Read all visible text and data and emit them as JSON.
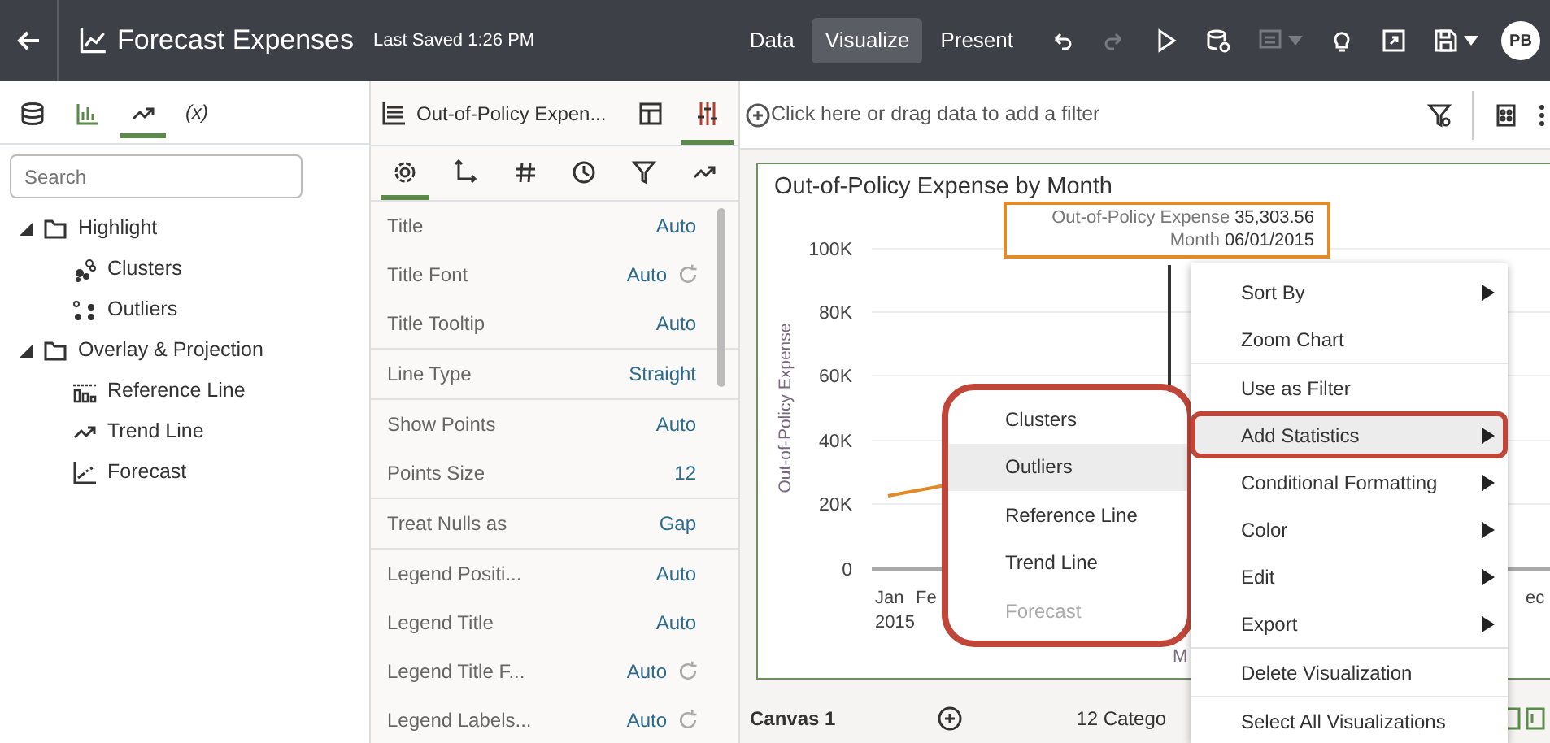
{
  "app_bar": {
    "title": "Forecast Expenses",
    "saved": "Last Saved 1:26 PM",
    "modes": [
      {
        "label": "Data",
        "selected": false
      },
      {
        "label": "Visualize",
        "selected": true
      },
      {
        "label": "Present",
        "selected": false
      }
    ],
    "tools": [
      {
        "kind": "undo",
        "disabled": false
      },
      {
        "kind": "redo",
        "disabled": true
      },
      {
        "kind": "play",
        "disabled": false
      },
      {
        "kind": "data",
        "disabled": false
      },
      {
        "kind": "narrate",
        "disabled": true
      },
      {
        "kind": "bulb",
        "disabled": false
      },
      {
        "kind": "export",
        "disabled": false
      },
      {
        "kind": "save",
        "disabled": false
      }
    ],
    "avatar": "PB"
  },
  "data_panel": {
    "tabs": [
      {
        "kind": "database",
        "selected": false
      },
      {
        "kind": "bars",
        "selected": false
      },
      {
        "kind": "trend",
        "selected": true
      },
      {
        "kind": "text",
        "label": "(x)",
        "selected": false
      }
    ],
    "search": {
      "placeholder": "Search"
    },
    "tree": [
      {
        "label": "Highlight",
        "expanded": true,
        "children": [
          {
            "label": "Clusters",
            "kind": "clusters"
          },
          {
            "label": "Outliers",
            "kind": "outliers"
          }
        ]
      },
      {
        "label": "Overlay & Projection",
        "expanded": true,
        "children": [
          {
            "label": "Reference Line",
            "kind": "reference"
          },
          {
            "label": "Trend Line",
            "kind": "trend"
          },
          {
            "label": "Forecast",
            "kind": "forecast"
          }
        ]
      }
    ]
  },
  "properties": {
    "title": "Out-of-Policy Expen...",
    "views": [
      {
        "kind": "layout",
        "selected": false
      },
      {
        "kind": "sliders",
        "selected": true
      }
    ],
    "tabs": [
      {
        "kind": "gear",
        "selected": true
      },
      {
        "kind": "axis",
        "selected": false
      },
      {
        "kind": "hash",
        "selected": false
      },
      {
        "kind": "clock",
        "selected": false
      },
      {
        "kind": "filter",
        "selected": false
      },
      {
        "kind": "trend",
        "selected": false
      }
    ],
    "groups": [
      [
        {
          "label": "Title",
          "value": "Auto",
          "reset": false
        },
        {
          "label": "Title Font",
          "value": "Auto",
          "reset": true
        },
        {
          "label": "Title Tooltip",
          "value": "Auto",
          "reset": false
        }
      ],
      [
        {
          "label": "Line Type",
          "value": "Straight",
          "reset": false
        }
      ],
      [
        {
          "label": "Show Points",
          "value": "Auto",
          "reset": false
        },
        {
          "label": "Points Size",
          "value": "12",
          "reset": false
        }
      ],
      [
        {
          "label": "Treat Nulls as",
          "value": "Gap",
          "reset": false
        }
      ],
      [
        {
          "label": "Legend Positi...",
          "value": "Auto",
          "reset": false
        },
        {
          "label": "Legend Title",
          "value": "Auto",
          "reset": false
        },
        {
          "label": "Legend Title F...",
          "value": "Auto",
          "reset": true
        },
        {
          "label": "Legend Labels...",
          "value": "Auto",
          "reset": true
        }
      ]
    ]
  },
  "filter_bar": {
    "placeholder": "Click here or drag data to add a filter"
  },
  "chart": {
    "title": "Out-of-Policy Expense by Month",
    "y_title": "Out-of-Policy Expense",
    "y_ticks": [
      "100K",
      "80K",
      "60K",
      "40K",
      "20K",
      "0"
    ],
    "x_labels": [
      {
        "line1": "Jan",
        "line2": "2015"
      },
      {
        "line1": "Fe"
      }
    ],
    "x_title": "M",
    "x_label_end": "ec"
  },
  "tooltip": {
    "rows": [
      {
        "label": "Out-of-Policy Expense",
        "value": "35,303.56"
      },
      {
        "label": "Month",
        "value": "06/01/2015"
      }
    ]
  },
  "submenu": {
    "callout": true,
    "items": [
      {
        "label": "Clusters",
        "selected": false,
        "disabled": false
      },
      {
        "label": "Outliers",
        "selected": true,
        "disabled": false
      },
      {
        "label": "Reference Line",
        "selected": false,
        "disabled": false
      },
      {
        "label": "Trend Line",
        "selected": false,
        "disabled": false
      },
      {
        "label": "Forecast",
        "selected": false,
        "disabled": true
      }
    ]
  },
  "context_menu": {
    "groups": [
      [
        {
          "label": "Sort By",
          "submenu": true,
          "selected": false
        },
        {
          "label": "Zoom Chart",
          "submenu": false,
          "selected": false
        }
      ],
      [
        {
          "label": "Use as Filter",
          "submenu": false,
          "selected": false
        },
        {
          "label": "Add Statistics",
          "submenu": true,
          "selected": true,
          "callout": true
        },
        {
          "label": "Conditional Formatting",
          "submenu": true,
          "selected": false
        },
        {
          "label": "Color",
          "submenu": true,
          "selected": false
        },
        {
          "label": "Edit",
          "submenu": true,
          "selected": false
        },
        {
          "label": "Export",
          "submenu": true,
          "selected": false
        }
      ],
      [
        {
          "label": "Delete Visualization",
          "submenu": false,
          "selected": false
        }
      ],
      [
        {
          "label": "Select All Visualizations",
          "submenu": false,
          "selected": false
        }
      ]
    ]
  },
  "canvas_bar": {
    "tab": "Canvas 1",
    "info": "12 Catego"
  }
}
